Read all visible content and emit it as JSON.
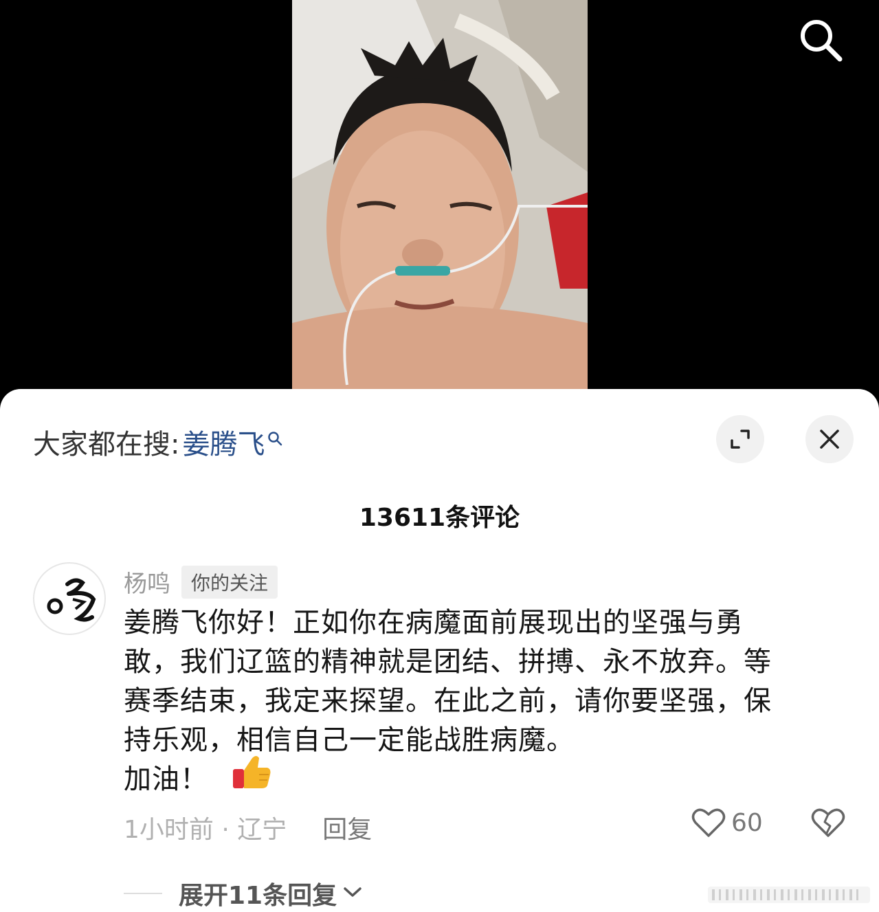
{
  "video": {
    "search_icon": "search-icon"
  },
  "sheet": {
    "search_hint_prefix": "大家都在搜:",
    "search_hint_term": "姜腾飞",
    "comment_count_title": "13611条评论"
  },
  "comment": {
    "author": "杨鸣",
    "badge": "你的关注",
    "lines": [
      "姜腾飞你好！正如你在病魔面前展现出的坚强与勇",
      "敢，我们辽篮的精神就是团结、拼搏、永不放弃。等",
      "赛季结束，我定来探望。在此之前，请你要坚强，保",
      "持乐观，相信自己一定能战胜病魔。",
      "加油！"
    ],
    "time_location": "1小时前 · 辽宁",
    "reply_label": "回复",
    "like_count": "60",
    "expand_replies": "展开11条回复"
  },
  "colors": {
    "link": "#2a4f8a",
    "thumb": "#f5b428",
    "sleeve": "#e0303a"
  }
}
